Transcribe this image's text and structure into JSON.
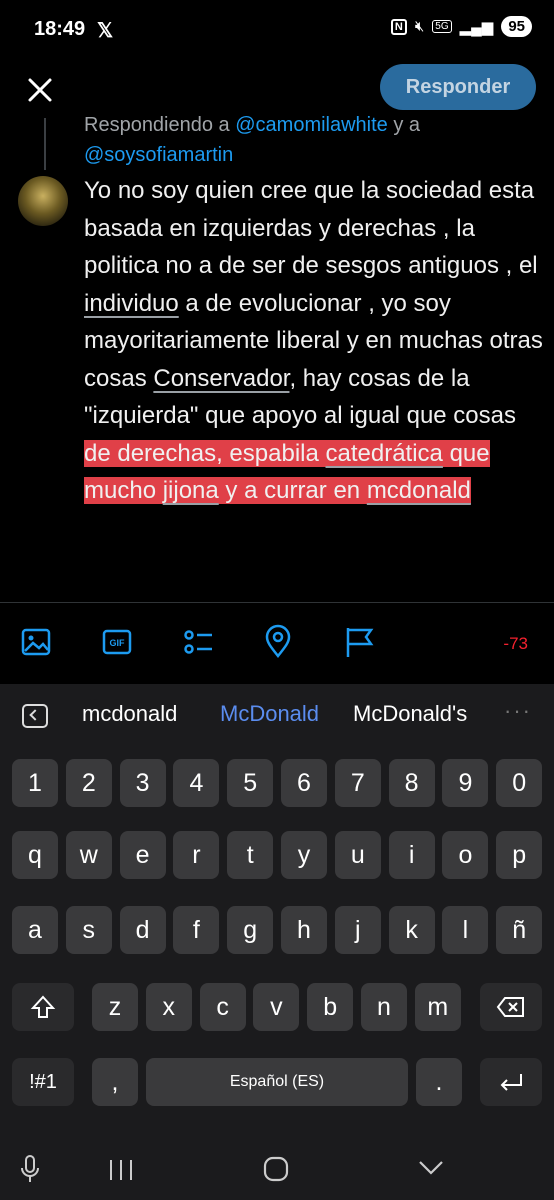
{
  "status_bar": {
    "time": "18:49",
    "app_logo": "𝕏",
    "tag_5g": "5G",
    "battery": "95"
  },
  "header": {
    "reply_button": "Responder"
  },
  "reply_context": {
    "prefix": "Respondiendo a ",
    "mention1": "@camomilawhite",
    "mid": " y a",
    "mention2": "@soysofiamartin"
  },
  "tweet": {
    "p1": "Yo no soy quien cree que la sociedad esta basada en izquierdas y derechas , la politica no a de ser de sesgos antiguos , el ",
    "u1": "individuo",
    "p2": " a de evolucionar , yo soy mayoritariamente liberal y en muchas otras cosas ",
    "u2": "Conservador",
    "p3": ",  hay cosas de la \"izquierda\" que apoyo al igual que cosas ",
    "h1": "de derechas, espabila ",
    "h2": "catedrática",
    "h3": " que mucho ",
    "h4": "jijona",
    "h5": " y a currar en ",
    "h6": "mcdonald"
  },
  "toolbar": {
    "char_count": "-73",
    "gif_label": "GIF"
  },
  "keyboard": {
    "suggestions": [
      "mcdonald",
      "McDonald",
      "McDonald's"
    ],
    "more": "···",
    "row_numbers": [
      "1",
      "2",
      "3",
      "4",
      "5",
      "6",
      "7",
      "8",
      "9",
      "0"
    ],
    "row1": [
      "q",
      "w",
      "e",
      "r",
      "t",
      "y",
      "u",
      "i",
      "o",
      "p"
    ],
    "row2": [
      "a",
      "s",
      "d",
      "f",
      "g",
      "h",
      "j",
      "k",
      "l",
      "ñ"
    ],
    "row3": [
      "z",
      "x",
      "c",
      "v",
      "b",
      "n",
      "m"
    ],
    "symbols": "!#1",
    "comma": ",",
    "space": "Español (ES)",
    "period": "."
  }
}
